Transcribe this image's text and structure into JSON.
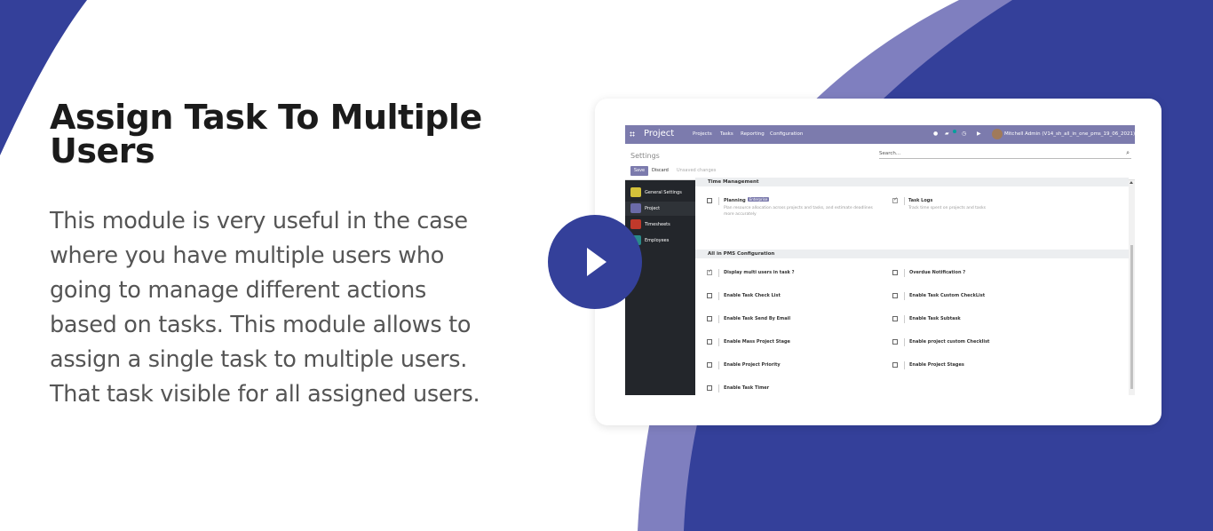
{
  "colors": {
    "accent_dark": "#34409a",
    "accent_light": "#7f7fbf",
    "odoo_purple": "#7c7bad",
    "sidebar_dark": "#23262b"
  },
  "headline": [
    "Assign Task To Multiple",
    "Users"
  ],
  "description": [
    "This module is very useful in the case",
    "where you have multiple users who",
    "going to manage different actions",
    "based on tasks. This module allows to",
    "assign a single task to multiple users.",
    "That task visible for all assigned users."
  ],
  "play_icon": "play-icon",
  "app": {
    "brand": "Project",
    "menu": [
      "Projects",
      "Tasks",
      "Reporting",
      "Configuration"
    ],
    "user": "Mitchell Admin (V14_sh_all_in_one_pms_19_06_2021)",
    "control_panel": {
      "title": "Settings",
      "search_placeholder": "Search...",
      "save": "Save",
      "discard": "Discard",
      "unsaved": "Unsaved changes"
    },
    "sidebar": [
      {
        "label": "General Settings",
        "icon": "settings-app-icon"
      },
      {
        "label": "Project",
        "icon": "project-app-icon"
      },
      {
        "label": "Timesheets",
        "icon": "timesheets-app-icon"
      },
      {
        "label": "Employees",
        "icon": "employees-app-icon"
      }
    ],
    "time_management": {
      "heading": "Time Management",
      "planning_label": "Planning",
      "planning_badge": "Enterprise",
      "planning_desc": "Plan resource allocation across projects and tasks, and estimate deadlines more accurately",
      "tasklogs_label": "Task Logs",
      "tasklogs_desc": "Track time spent on projects and tasks"
    },
    "pms": {
      "heading": "All in PMS Configuration",
      "left": [
        {
          "label": "Display multi users in task ?",
          "checked": true
        },
        {
          "label": "Enable Task Check List",
          "checked": false
        },
        {
          "label": "Enable Task Send By Email",
          "checked": false
        },
        {
          "label": "Enable Mass Project Stage",
          "checked": false
        },
        {
          "label": "Enable Project Priority",
          "checked": false
        },
        {
          "label": "Enable Task Timer",
          "checked": false
        }
      ],
      "right": [
        {
          "label": "Overdue Notification ?",
          "checked": false
        },
        {
          "label": "Enable Task Custom CheckList",
          "checked": false
        },
        {
          "label": "Enable Task Subtask",
          "checked": false
        },
        {
          "label": "Enable project custom Checklist",
          "checked": false
        },
        {
          "label": "Enable Project Stages",
          "checked": false
        }
      ]
    }
  }
}
